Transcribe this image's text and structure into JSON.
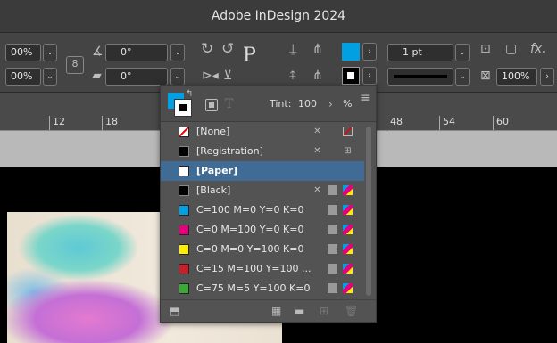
{
  "app": {
    "title": "Adobe InDesign 2024"
  },
  "control": {
    "scale_x": "00%",
    "scale_y": "00%",
    "rotate": "0°",
    "shear": "0°",
    "stroke_weight": "1 pt",
    "opacity": "100%",
    "text_frame_glyph": "P",
    "fx_label": "fx."
  },
  "ruler": {
    "ticks": [
      "12",
      "18",
      "48",
      "54",
      "60"
    ]
  },
  "swatches": {
    "tint_label": "Tint:",
    "tint_value": "100",
    "tint_unit": "%",
    "items": [
      {
        "name": "[None]",
        "color": "#ffffff"
      },
      {
        "name": "[Registration]",
        "color": "#000000"
      },
      {
        "name": "[Paper]",
        "color": "#ffffff"
      },
      {
        "name": "[Black]",
        "color": "#000000"
      },
      {
        "name": "C=100 M=0 Y=0 K=0",
        "color": "#00a0e3"
      },
      {
        "name": "C=0 M=100 Y=0 K=0",
        "color": "#e6007e"
      },
      {
        "name": "C=0 M=0 Y=100 K=0",
        "color": "#ffed00"
      },
      {
        "name": "C=15 M=100 Y=100 ...",
        "color": "#c8202a"
      },
      {
        "name": "C=75 M=5 Y=100 K=0",
        "color": "#3aa935"
      }
    ]
  },
  "colors": {
    "accent": "#00a0e3",
    "selection": "#3f6b94"
  }
}
